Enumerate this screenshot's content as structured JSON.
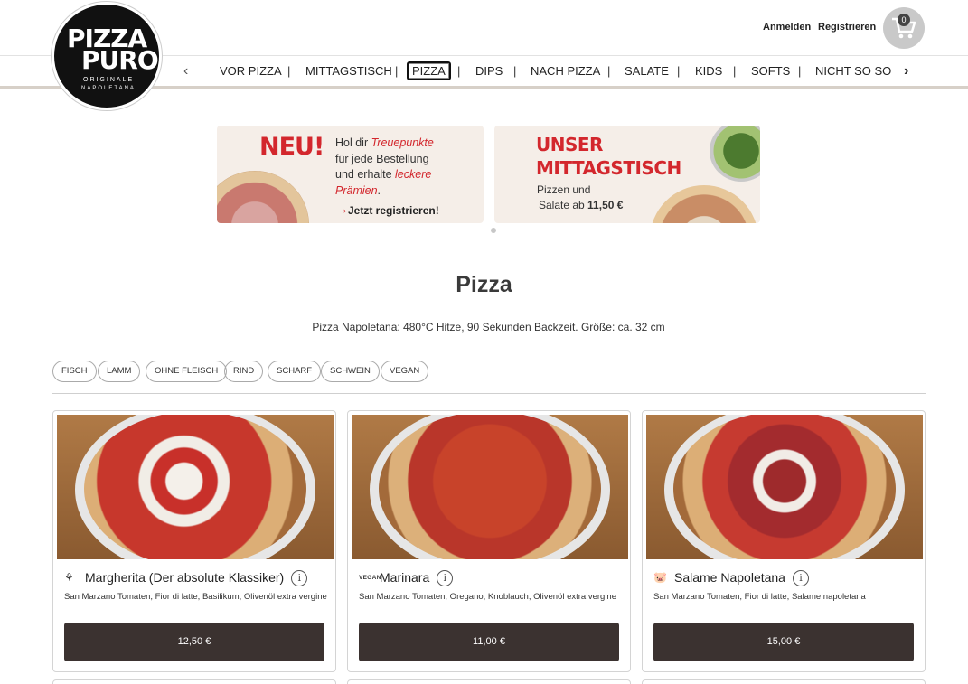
{
  "logo": {
    "line1": "PIZZA",
    "line2": "PURO",
    "line3": "ORIGINALE",
    "line4": "NAPOLETANA"
  },
  "header": {
    "login": "Anmelden",
    "register": "Registrieren",
    "cart_count": "0"
  },
  "nav": {
    "items": [
      "VOR PIZZA",
      "MITTAGSTISCH",
      "PIZZA",
      "DIPS",
      "NACH PIZZA",
      "SALATE",
      "KIDS",
      "SOFTS",
      "NICHT SO SO"
    ],
    "separator": "|",
    "active": "PIZZA",
    "prev_icon": "‹",
    "next_icon": "›"
  },
  "banners": [
    {
      "headline": "NEU!",
      "line1_pre": "Hol dir ",
      "line1_em": "Treuepunkte",
      "line2": "für jede Bestellung",
      "line3_pre": "und erhalte ",
      "line3_em": "leckere",
      "line4_em": "Prämien",
      "line4_post": ".",
      "cta": "Jetzt registrieren!"
    },
    {
      "headline_1": "UNSER",
      "headline_2": "MITTAGSTISCH",
      "text_1": "Pizzen und",
      "text_2_pre": "Salate ab ",
      "text_2_bold": "11,50 €"
    }
  ],
  "section": {
    "title": "Pizza",
    "subtitle": "Pizza Napoletana: 480°C Hitze, 90 Sekunden Backzeit. Größe: ca. 32 cm"
  },
  "filters": [
    "FISCH",
    "LAMM",
    "OHNE FLEISCH",
    "RIND",
    "SCHARF",
    "SCHWEIN",
    "VEGAN"
  ],
  "products": [
    {
      "name": "Margherita (Der absolute Klassiker)",
      "icon": "vegetarian-icon",
      "icon_text": "⚘",
      "description": "San Marzano Tomaten, Fior di latte, Basilikum, Olivenöl extra vergine",
      "price": "12,50 €"
    },
    {
      "name": "Marinara",
      "icon": "vegan-icon",
      "icon_text": "VEGAN",
      "description": "San Marzano Tomaten, Oregano, Knoblauch, Olivenöl extra vergine",
      "price": "11,00 €"
    },
    {
      "name": "Salame Napoletana",
      "icon": "pig-icon",
      "icon_text": "🐷",
      "description": "San Marzano Tomaten, Fior di latte, Salame napoletana",
      "price": "15,00 €"
    }
  ],
  "info_icon": "i"
}
